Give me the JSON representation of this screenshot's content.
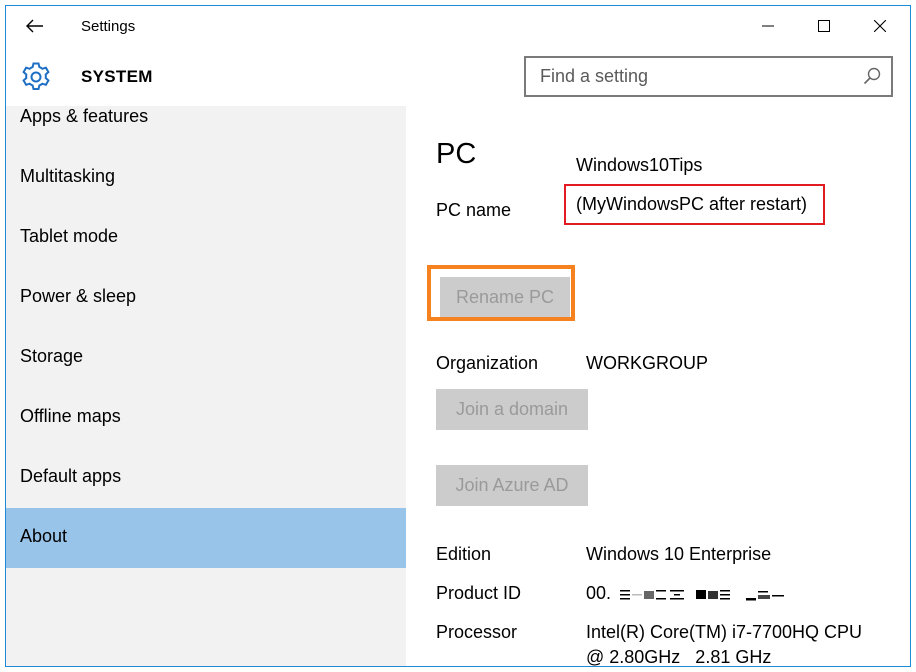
{
  "window": {
    "title": "Settings"
  },
  "header": {
    "title": "SYSTEM",
    "search_placeholder": "Find a setting"
  },
  "sidebar": {
    "items": [
      {
        "label": "Apps & features",
        "active": false
      },
      {
        "label": "Multitasking",
        "active": false
      },
      {
        "label": "Tablet mode",
        "active": false
      },
      {
        "label": "Power & sleep",
        "active": false
      },
      {
        "label": "Storage",
        "active": false
      },
      {
        "label": "Offline maps",
        "active": false
      },
      {
        "label": "Default apps",
        "active": false
      },
      {
        "label": "About",
        "active": true
      }
    ]
  },
  "main": {
    "heading": "PC",
    "pc_name_label": "PC name",
    "pc_name_value": "Windows10Tips",
    "pc_name_after_restart": "(MyWindowsPC after restart)",
    "rename_button": "Rename PC",
    "organization_label": "Organization",
    "organization_value": "WORKGROUP",
    "join_domain_button": "Join a domain",
    "join_azure_button": "Join Azure AD",
    "edition_label": "Edition",
    "edition_value": "Windows 10 Enterprise",
    "product_id_label": "Product ID",
    "product_id_value": "00.",
    "processor_label": "Processor",
    "processor_value_line1": "Intel(R) Core(TM) i7-7700HQ CPU",
    "processor_value_line2": "@ 2.80GHz   2.81 GHz"
  },
  "colors": {
    "accent": "#1f6fc5",
    "active_nav": "#99c4e9",
    "sidebar_bg": "#f2f2f2",
    "highlight_red": "#e21b23",
    "highlight_orange": "#f5821f",
    "disabled_button_bg": "#cccccc",
    "disabled_button_text": "#9a9a9a"
  },
  "icons": {
    "back": "back-arrow-icon",
    "minimize": "minimize-icon",
    "maximize": "maximize-icon",
    "close": "close-icon",
    "settings": "gear-icon",
    "search": "search-icon"
  }
}
